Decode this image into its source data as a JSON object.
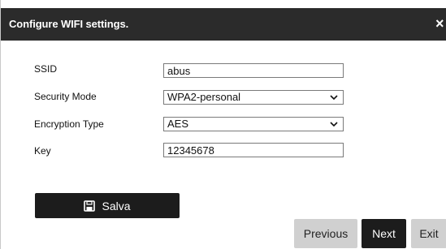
{
  "dialog": {
    "title": "Configure WIFI settings.",
    "close_glyph": "×"
  },
  "form": {
    "ssid_label": "SSID",
    "ssid_value": "abus",
    "security_mode_label": "Security Mode",
    "security_mode_value": "WPA2-personal",
    "encryption_type_label": "Encryption Type",
    "encryption_type_value": "AES",
    "key_label": "Key",
    "key_value": "12345678"
  },
  "buttons": {
    "save_label": "Salva",
    "save_icon": "floppy-disk-icon",
    "previous_label": "Previous",
    "next_label": "Next",
    "exit_label": "Exit"
  },
  "colors": {
    "titlebar": "#2b2b2b",
    "primary_button": "#1c1c1c",
    "secondary_button": "#d0d0d0"
  }
}
